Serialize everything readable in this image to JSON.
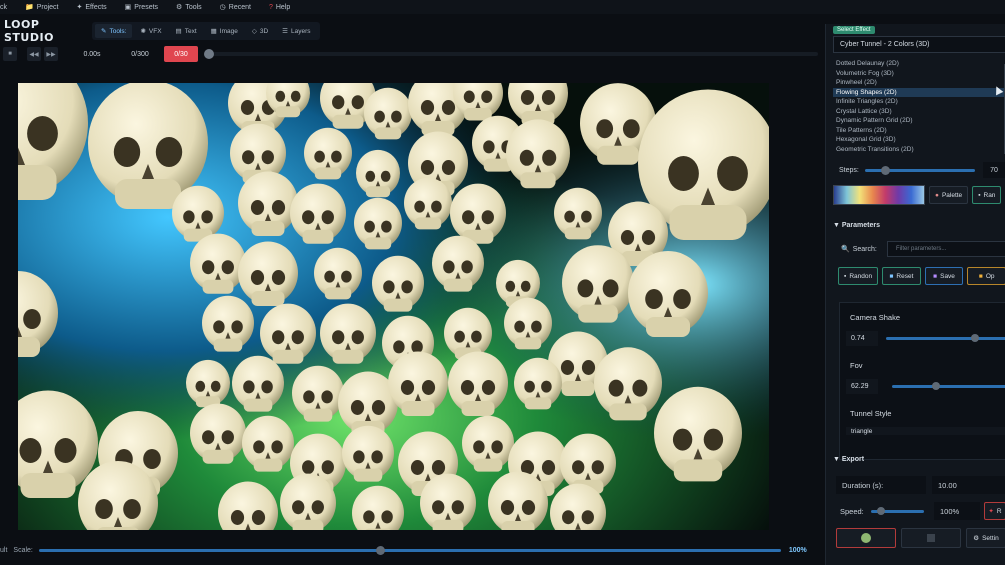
{
  "menu": [
    {
      "label": "ck",
      "icon": ""
    },
    {
      "label": "Project",
      "icon": "folder-icon"
    },
    {
      "label": "Effects",
      "icon": "sparkle-icon"
    },
    {
      "label": "Presets",
      "icon": "preset-icon"
    },
    {
      "label": "Tools",
      "icon": "wrench-icon"
    },
    {
      "label": "Recent",
      "icon": "clock-icon"
    },
    {
      "label": "Help",
      "icon": "help-icon"
    }
  ],
  "app": {
    "title": "LOOP STUDIO"
  },
  "tabs": [
    "Tools:",
    "VFX",
    "Text",
    "Image",
    "3D",
    "Layers"
  ],
  "transport": {
    "time": "0.00s",
    "frames": "0/300",
    "counter": "0/30"
  },
  "scale": {
    "label": "Scale:",
    "prefix": "ult",
    "value": "100%",
    "level": 0.46
  },
  "effect": {
    "badge": "Select Effect",
    "current": "Cyber Tunnel - 2 Colors (3D)",
    "list": [
      "Dotted Delaunay (2D)",
      "Volumetric Fog (3D)",
      "Pinwheel (2D)",
      "Flowing Shapes (2D)",
      "Infinite Triangles (2D)",
      "Crystal Lattice (3D)",
      "Dynamic Pattern Grid (2D)",
      "Tile Patterns (2D)",
      "Hexagonal Grid (3D)",
      "Geometric Transitions (2D)"
    ],
    "selected_index": 3
  },
  "steps": {
    "label": "Steps:",
    "value": "70"
  },
  "palette": {
    "button": "Palette",
    "random": "Ran"
  },
  "parameters": {
    "header": "Parameters",
    "search_label": "Search:",
    "search_placeholder": "Filter parameters...",
    "buttons": [
      "Randon",
      "Reset",
      "Save",
      "Op"
    ],
    "items": [
      {
        "name": "Camera Shake",
        "value": "0.74"
      },
      {
        "name": "Fov",
        "value": "62.29"
      },
      {
        "name": "Tunnel Style",
        "value": "triangle"
      }
    ]
  },
  "export": {
    "header": "Export",
    "duration_label": "Duration (s):",
    "duration_value": "10.00",
    "speed_label": "Speed:",
    "speed_value": "100%",
    "settings": "Settin",
    "render": "R"
  },
  "colors": {
    "accent": "#2b6fb0",
    "counter": "#e0464f",
    "selected": "#1f3a55"
  }
}
